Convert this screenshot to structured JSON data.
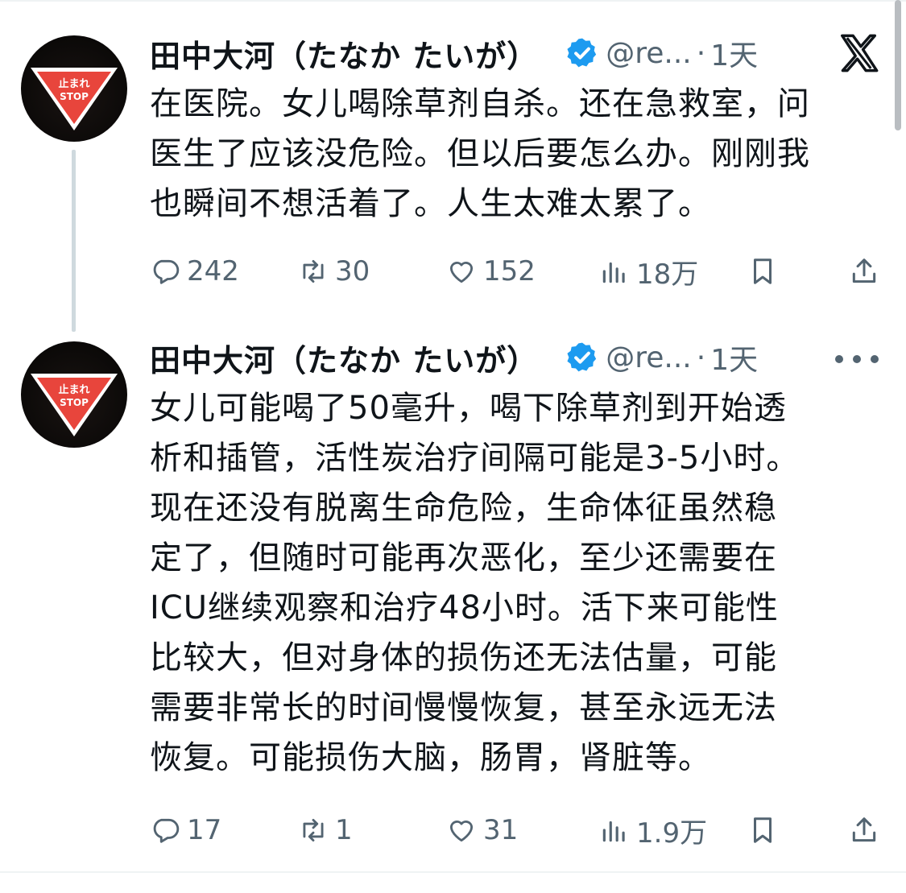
{
  "tweets": [
    {
      "author": "田中大河（たなか たいが）",
      "handle": "@re...",
      "separator": "·",
      "time": "1天",
      "text": "在医院。女儿喝除草剂自杀。还在急救室，问\n医生了应该没危险。但以后要怎么办。刚刚我\n也瞬间不想活着了。人生太难太累了。",
      "replies": "242",
      "retweets": "30",
      "likes": "152",
      "views": "18万",
      "avatar_text_top": "止まれ",
      "avatar_text_bottom": "STOP"
    },
    {
      "author": "田中大河（たなか たいが）",
      "handle": "@re...",
      "separator": "·",
      "time": "1天",
      "text": "女儿可能喝了50毫升，喝下除草剂到开始透\n析和插管，活性炭治疗间隔可能是3-5小时。\n现在还没有脱离生命危险，生命体征虽然稳\n定了，但随时可能再次恶化，至少还需要在\nICU继续观察和治疗48小时。活下来可能性\n比较大，但对身体的损伤还无法估量，可能\n需要非常长的时间慢慢恢复，甚至永远无法\n恢复。可能损伤大脑，肠胃，肾脏等。",
      "replies": "17",
      "retweets": "1",
      "likes": "31",
      "views": "1.9万",
      "avatar_text_top": "止まれ",
      "avatar_text_bottom": "STOP"
    }
  ],
  "icons": {
    "top_right": "x-logo-icon",
    "menu": "more-dots-icon",
    "reply": "reply-icon",
    "retweet": "retweet-icon",
    "like": "heart-icon",
    "views": "views-icon",
    "bookmark": "bookmark-icon",
    "share": "share-icon",
    "verified": "verified-badge-icon"
  },
  "colors": {
    "text": "#0f1419",
    "muted": "#536471",
    "verified": "#1d9bf0",
    "sign_red": "#e8453c"
  }
}
